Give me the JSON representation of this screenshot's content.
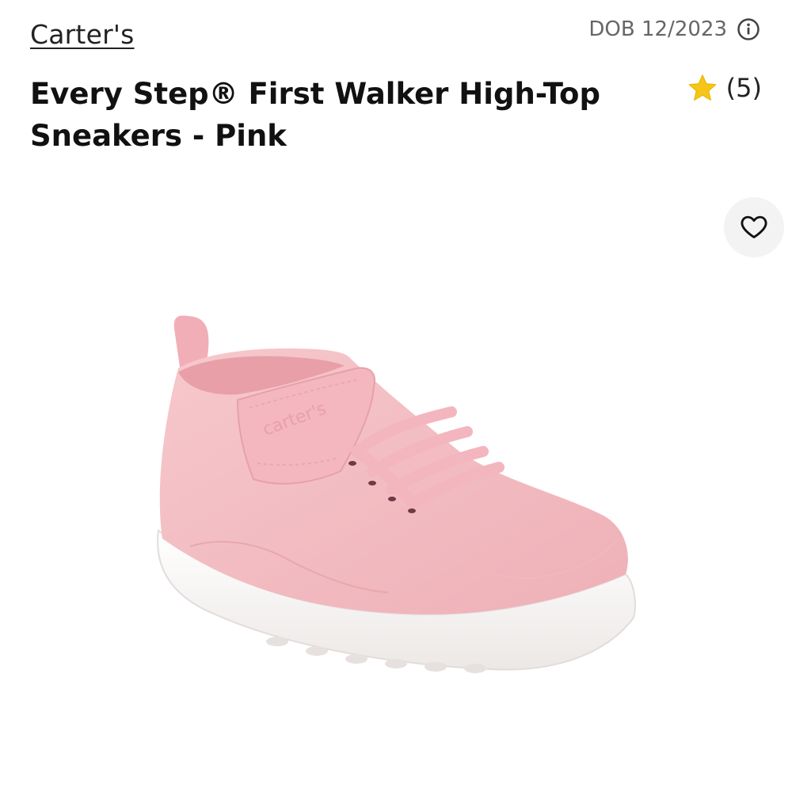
{
  "header": {
    "brand": "Carter's",
    "dob_label": "DOB 12/2023"
  },
  "product": {
    "title": "Every Step® First Walker High-Top Sneakers - Pink",
    "review_count": "(5)",
    "image_logo_text": "carter's"
  },
  "icons": {
    "info": "info-icon",
    "star": "star-icon",
    "favorite": "heart-outline-icon"
  },
  "colors": {
    "star": "#F5C518",
    "shoe": "#F4BCC2",
    "sole": "#F7F5F4",
    "fav_bg": "#F3F3F3"
  }
}
